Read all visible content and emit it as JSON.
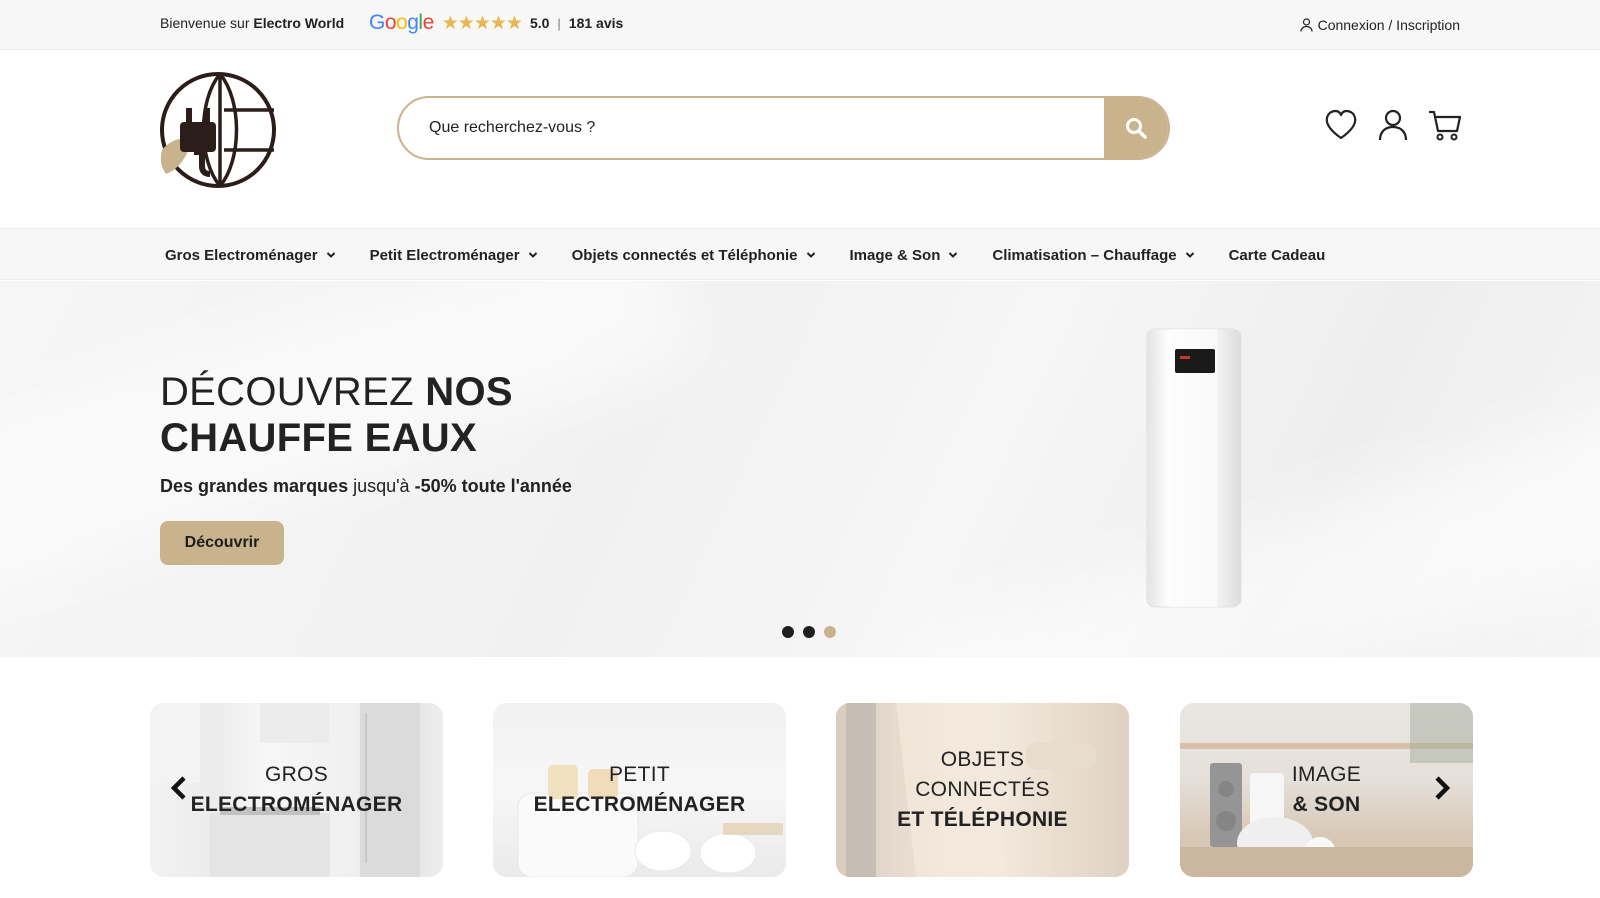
{
  "topbar": {
    "welcome_prefix": "Bienvenue sur",
    "welcome_brand": "Electro World",
    "google_letters": [
      "G",
      "o",
      "o",
      "g",
      "l",
      "e"
    ],
    "stars": "★★★★★",
    "rating": "5.0",
    "separator": "|",
    "reviews": "181 avis",
    "login": "Connexion / Inscription"
  },
  "search": {
    "placeholder": "Que recherchez-vous ?"
  },
  "nav": {
    "items": [
      {
        "label": "Gros Electroménager"
      },
      {
        "label": "Petit Electroménager"
      },
      {
        "label": "Objets connectés et Téléphonie"
      },
      {
        "label": "Image & Son"
      },
      {
        "label": "Climatisation – Chauffage"
      },
      {
        "label": "Carte Cadeau"
      }
    ]
  },
  "hero": {
    "title_line1_light": "DÉCOUVREZ",
    "title_line1_bold": "NOS",
    "title_line2_bold": "CHAUFFE EAUX",
    "sub_bold1": "Des grandes marques",
    "sub_light": "jusqu'à",
    "sub_bold2": "-50% toute l'année",
    "button": "Découvrir",
    "slides": 3,
    "active_slide": 3
  },
  "categories": [
    {
      "line1": "GROS",
      "line2": "ELECTROMÉNAGER"
    },
    {
      "line1": "PETIT",
      "line2": "ELECTROMÉNAGER"
    },
    {
      "line1": "OBJETS",
      "line1b": "CONNECTÉS",
      "line2": "ET TÉLÉPHONIE"
    },
    {
      "line1": "IMAGE",
      "line2": "& SON"
    }
  ],
  "colors": {
    "accent": "#c9b38d",
    "text": "#222222",
    "topbar_bg": "#f7f7f7",
    "star": "#e8b64c"
  }
}
